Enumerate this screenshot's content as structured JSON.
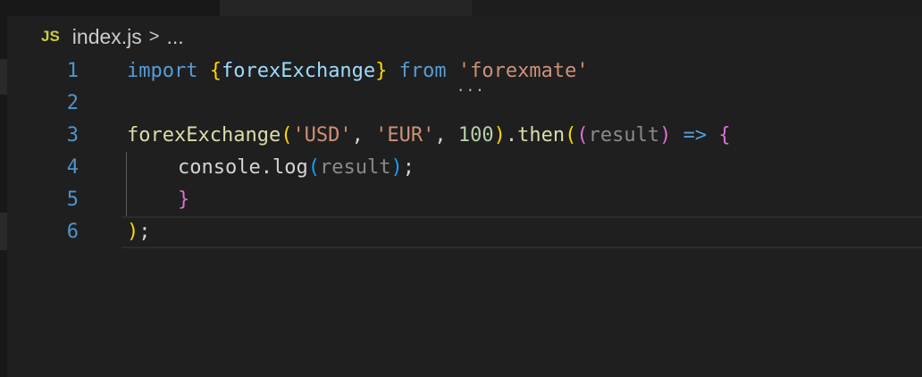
{
  "breadcrumb": {
    "file_badge": "JS",
    "file_name": "index.js",
    "separator": ">",
    "more": "..."
  },
  "editor": {
    "line_numbers": [
      "1",
      "2",
      "3",
      "4",
      "5",
      "6"
    ],
    "line1": {
      "import_kw": "import",
      "open_brace": "{",
      "name": "forexExchange",
      "close_brace": "}",
      "from_kw": "from",
      "module": "'forexmate'",
      "hint_marker": "..."
    },
    "line3": {
      "fn": "forexExchange",
      "open_paren": "(",
      "arg1": "'USD'",
      "comma1": ", ",
      "arg2": "'EUR'",
      "comma2": ", ",
      "arg3": "100",
      "close_paren": ")",
      "dot": ".",
      "then": "then",
      "paren_a": "(",
      "paren_b": "(",
      "param": "result",
      "paren_c": ")",
      "arrow": " => ",
      "brace_open": "{"
    },
    "line4": {
      "console": "console",
      "dot": ".",
      "log": "log",
      "paren_open": "(",
      "arg": "result",
      "paren_close": ")",
      "semi": ";"
    },
    "line5": {
      "brace_close": "}"
    },
    "line6": {
      "paren_close": ")",
      "semi": ";"
    }
  },
  "colors": {
    "background": "#1f1f1f",
    "line_number": "#4e94ce",
    "keyword": "#569cd6",
    "function": "#dcdcaa",
    "string": "#ce9178",
    "number": "#b5cea8"
  }
}
